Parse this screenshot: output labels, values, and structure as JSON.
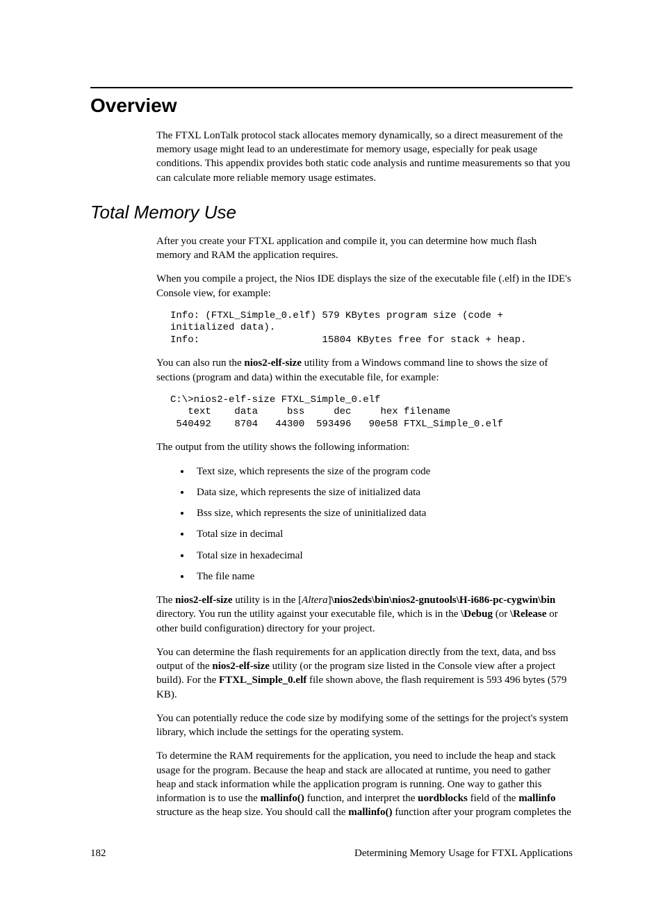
{
  "headings": {
    "overview": "Overview",
    "total_memory": "Total Memory Use"
  },
  "paragraphs": {
    "overview_p1": "The FTXL LonTalk protocol stack allocates memory dynamically, so a direct measurement of the memory usage might lead to an underestimate for memory usage, especially for peak usage conditions.  This appendix provides both static code analysis and runtime measurements so that you can calculate more reliable memory usage estimates.",
    "tm_p1": "After you create your FTXL application and compile it, you can determine how much flash memory and RAM the application requires.",
    "tm_p2": "When you compile a project, the Nios IDE displays the size of the executable file (.elf) in the IDE's Console view, for example:",
    "tm_p3_a": "You can also run the ",
    "tm_p3_b": "nios2-elf-size",
    "tm_p3_c": " utility from a Windows command line to shows the size of sections (program and data) within the executable file, for example:",
    "tm_p4": "The output from the utility shows the following information:",
    "tm_p5_a": "The ",
    "tm_p5_b": "nios2-elf-size",
    "tm_p5_c": " utility is in the [",
    "tm_p5_d": "Altera",
    "tm_p5_e": "]",
    "tm_p5_f": "\\nios2eds\\bin\\nios2-gnutools\\H-i686-pc-cygwin\\bin",
    "tm_p5_g": " directory.  You run the utility against your executable file, which is in the ",
    "tm_p5_h": "\\Debug",
    "tm_p5_i": " (or ",
    "tm_p5_j": "\\Release",
    "tm_p5_k": " or other build configuration) directory for your project.",
    "tm_p6_a": "You can determine the flash requirements for an application directly from the text, data, and bss output of the ",
    "tm_p6_b": "nios2-elf-size",
    "tm_p6_c": " utility (or the program size listed in the Console view after a project build).  For the ",
    "tm_p6_d": "FTXL_Simple_0.elf",
    "tm_p6_e": " file shown above, the flash requirement is 593 496 bytes (579 KB).",
    "tm_p7": "You can potentially reduce the code size by modifying some of the settings for the project's system library, which include the settings for the operating system.",
    "tm_p8_a": "To determine the RAM requirements for the application, you need to include the heap and stack usage for the program.  Because the heap and stack are allocated at runtime, you need to gather heap and stack information while the application program is running.  One way to gather this information is to use the ",
    "tm_p8_b": "mallinfo()",
    "tm_p8_c": " function, and interpret the ",
    "tm_p8_d": "uordblocks",
    "tm_p8_e": " field of the ",
    "tm_p8_f": "mallinfo",
    "tm_p8_g": " structure as the heap size.  You should call the ",
    "tm_p8_h": "mallinfo()",
    "tm_p8_i": " function after your program completes the"
  },
  "code": {
    "block1": "Info: (FTXL_Simple_0.elf) 579 KBytes program size (code +\ninitialized data).\nInfo:                     15804 KBytes free for stack + heap.",
    "block2": "C:\\>nios2-elf-size FTXL_Simple_0.elf\n   text    data     bss     dec     hex filename\n 540492    8704   44300  593496   90e58 FTXL_Simple_0.elf"
  },
  "bullets": {
    "b1": "Text size, which represents the size of the program code",
    "b2": "Data size, which represents the size of initialized data",
    "b3": "Bss size, which represents the size of uninitialized data",
    "b4": "Total size in decimal",
    "b5": "Total size in hexadecimal",
    "b6": "The file name"
  },
  "footer": {
    "page": "182",
    "title": "Determining Memory Usage for FTXL Applications"
  }
}
